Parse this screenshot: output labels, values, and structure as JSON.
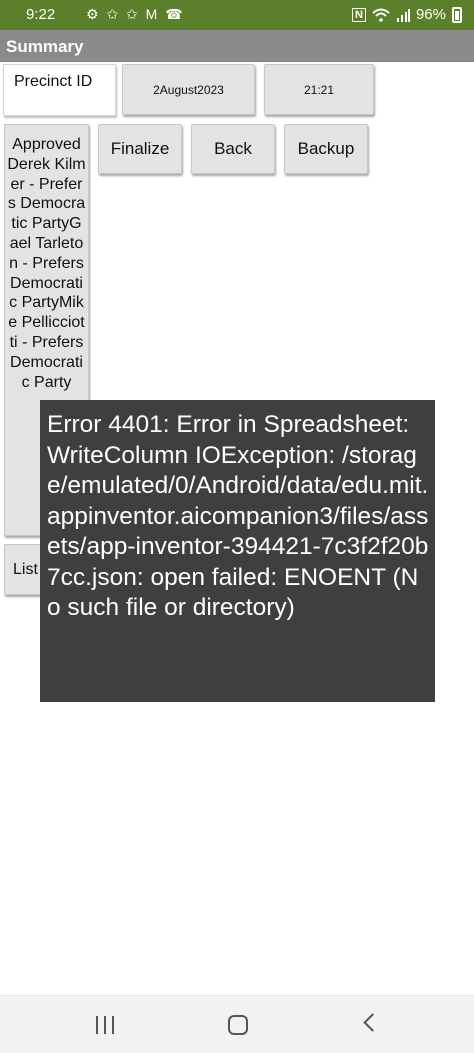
{
  "status_bar": {
    "time": "9:22",
    "left_icons": "⚙ ✩ ✩ M ☎",
    "nfc": "N",
    "battery_percent": "96%",
    "background_color": "#5b7f2a"
  },
  "title_bar": {
    "title": "Summary",
    "background_color": "#8a8a8a"
  },
  "fields": {
    "precinct_id": "Precinct ID",
    "date_button": "2August2023",
    "time_button": "21:21"
  },
  "buttons": {
    "finalize": "Finalize",
    "back": "Back",
    "backup": "Backup",
    "list": "List"
  },
  "candidate_list_text": "ApprovedDerek Kilmer - Prefers Democratic PartyGael Tarleton - Prefers Democratic PartyMike Pellicciotti - Prefers Democratic Party",
  "toast": {
    "message": "Error 4401: Error in Spreadsheet: WriteColumn IOException: /storage/emulated/0/Android/data/edu.mit.appinventor.aicompanion3/files/assets/app-inventor-394421-7c3f2f20b7cc.json: open failed: ENOENT (No such file or directory)",
    "background_color": "#3f3f3f"
  },
  "nav_bar": {
    "icons": [
      "recent-apps-icon",
      "home-icon",
      "back-icon"
    ]
  }
}
